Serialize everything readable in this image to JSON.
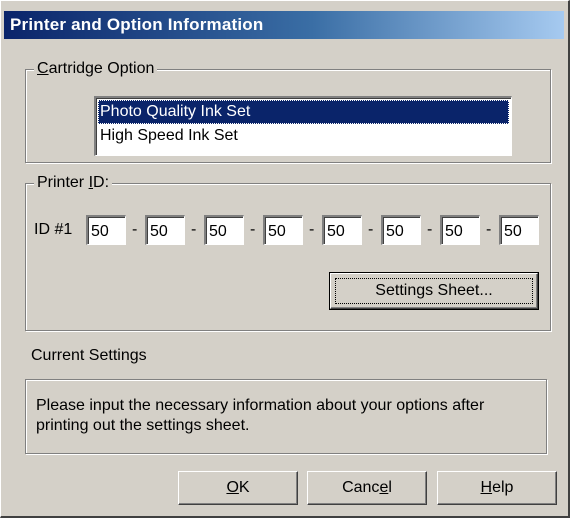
{
  "window": {
    "title": "Printer and Option Information"
  },
  "cartridge": {
    "label_prefix": "",
    "label_mnemonic": "C",
    "label_rest": "artridge Option",
    "options": [
      {
        "label": "Photo Quality Ink Set",
        "selected": true
      },
      {
        "label": "High Speed Ink Set",
        "selected": false
      }
    ]
  },
  "printer_id": {
    "label_prefix": "Printer ",
    "label_mnemonic": "I",
    "label_rest": "D:",
    "row_label": "ID #1",
    "separator": "-",
    "fields": [
      "50",
      "50",
      "50",
      "50",
      "50",
      "50",
      "50",
      "50"
    ],
    "settings_button": "Settings Sheet..."
  },
  "current_settings": {
    "label": "Current Settings",
    "message": "Please input the necessary information about your options after printing out the settings sheet."
  },
  "buttons": {
    "ok_mnemonic": "O",
    "ok_rest": "K",
    "cancel_prefix": "Canc",
    "cancel_mnemonic": "e",
    "cancel_rest": "l",
    "help_mnemonic": "H",
    "help_rest": "elp"
  }
}
